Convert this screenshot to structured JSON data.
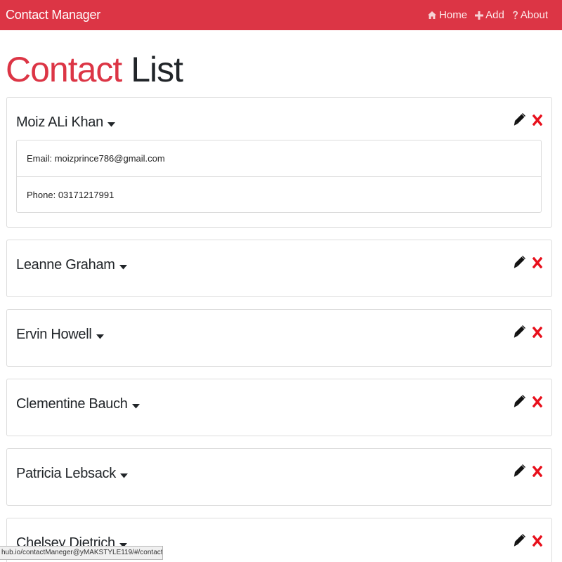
{
  "app": {
    "brand": "Contact Manager",
    "accent_color": "#dc3545"
  },
  "nav": {
    "items": [
      {
        "label": "Home",
        "icon": "home-icon"
      },
      {
        "label": "Add",
        "icon": "plus-icon"
      },
      {
        "label": "About",
        "icon": "question-icon"
      }
    ]
  },
  "page": {
    "title_accent": "Contact",
    "title_rest": " List"
  },
  "contacts": [
    {
      "name": "Moiz ALi Khan",
      "expanded": true,
      "email_label": "Email: moizprince786@gmail.com",
      "phone_label": "Phone: 03171217991"
    },
    {
      "name": "Leanne Graham",
      "expanded": false
    },
    {
      "name": "Ervin Howell",
      "expanded": false
    },
    {
      "name": "Clementine Bauch",
      "expanded": false
    },
    {
      "name": "Patricia Lebsack",
      "expanded": false
    },
    {
      "name": "Chelsey Dietrich",
      "expanded": false
    }
  ],
  "icons": {
    "edit": "pencil-icon",
    "delete": "close-icon",
    "toggle": "caret-down-icon"
  },
  "status_bar": {
    "url": "hub.io/contactManeger@yMAKSTYLE119/#/contact/edit/11"
  }
}
